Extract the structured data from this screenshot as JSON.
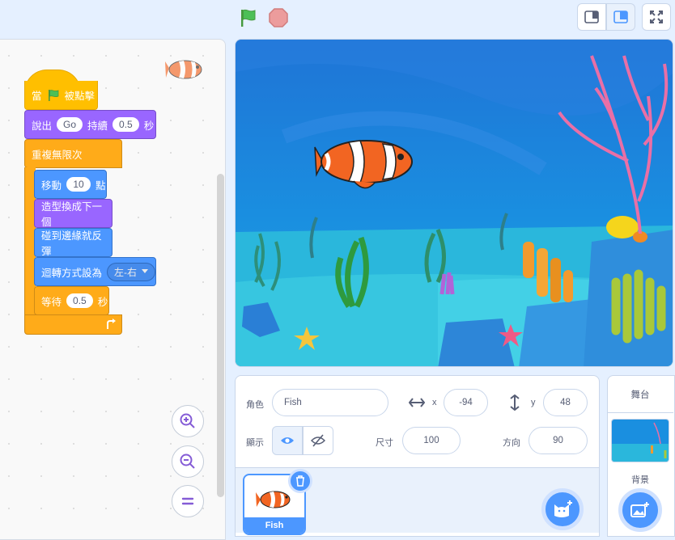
{
  "toolbar": {
    "green_flag_icon": "green-flag-icon",
    "stop_icon": "stop-sign-icon",
    "views": [
      "small-stage-icon",
      "normal-stage-icon",
      "fullscreen-icon"
    ]
  },
  "code": {
    "hat": {
      "label_when": "當",
      "label_clicked": "被點擊"
    },
    "say_block": {
      "label": "說出",
      "message": "Go",
      "label_for": "持續",
      "secs": "0.5",
      "label_secs": "秒"
    },
    "forever": {
      "label": "重複無限次"
    },
    "move_block": {
      "label": "移動",
      "steps": "10",
      "label_steps": "點"
    },
    "next_costume": {
      "label": "造型換成下一個"
    },
    "bounce": {
      "label": "碰到邊緣就反彈"
    },
    "rotation_style": {
      "label": "迴轉方式設為",
      "value": "左-右"
    },
    "wait_block": {
      "label": "等待",
      "secs": "0.5",
      "label_secs": "秒"
    },
    "zoom": {
      "in_icon": "zoom-in-icon",
      "out_icon": "zoom-out-icon",
      "reset_icon": "zoom-reset-icon"
    }
  },
  "sprite_info": {
    "sprite_label": "角色",
    "sprite_name": "Fish",
    "x_label": "x",
    "x_value": "-94",
    "y_label": "y",
    "y_value": "48",
    "show_label": "顯示",
    "size_label": "尺寸",
    "size_value": "100",
    "direction_label": "方向",
    "direction_value": "90"
  },
  "sprite_list": {
    "items": [
      {
        "name": "Fish",
        "selected": true
      }
    ]
  },
  "stage_pane": {
    "header": "舞台",
    "backdrop_label": "背景"
  },
  "colors": {
    "events": "#ffbf00",
    "looks": "#9966ff",
    "control": "#ffab19",
    "motion": "#4c97ff",
    "accent": "#4c97ff",
    "background": "#e5f0ff"
  }
}
